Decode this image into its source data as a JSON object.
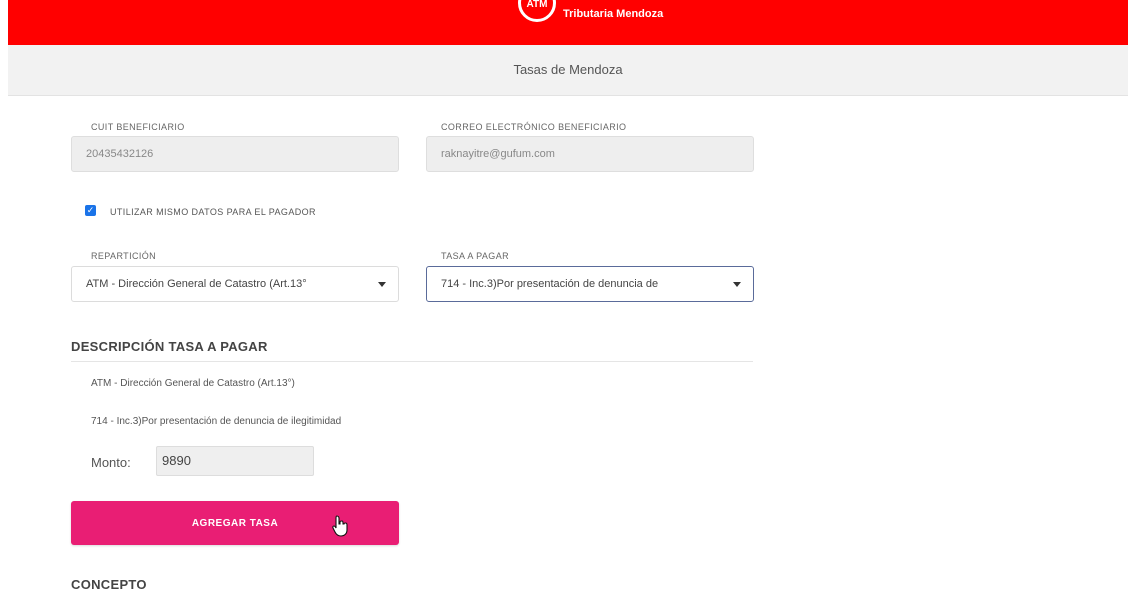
{
  "header": {
    "logo_text": "ATM",
    "brand_text": "Tributaria Mendoza"
  },
  "subheader": {
    "title": "Tasas de Mendoza"
  },
  "beneficiario": {
    "cuit_label": "CUIT BENEFICIARIO",
    "cuit_value": "20435432126",
    "email_label": "CORREO ELECTRÓNICO BENEFICIARIO",
    "email_value": "raknayitre@gufum.com"
  },
  "pagador_checkbox": {
    "checked": true,
    "label": "UTILIZAR MISMO DATOS PARA EL PAGADOR"
  },
  "reparticion": {
    "label": "REPARTICIÓN",
    "selected": "ATM - Dirección General de Catastro (Art.13°"
  },
  "tasa": {
    "label": "TASA A PAGAR",
    "selected": "714 - Inc.3)Por presentación de denuncia de"
  },
  "descripcion": {
    "title": "DESCRIPCIÓN TASA A PAGAR",
    "line1": "ATM - Dirección General de Catastro (Art.13°)",
    "line2": "714 - Inc.3)Por presentación de denuncia de ilegitimidad",
    "monto_label": "Monto:",
    "monto_value": "9890"
  },
  "actions": {
    "agregar_label": "AGREGAR TASA"
  },
  "concepto": {
    "title": "CONCEPTO"
  },
  "colors": {
    "header_red": "#ff0000",
    "button_pink": "#e91e74",
    "checkbox_blue": "#1a73e8"
  }
}
